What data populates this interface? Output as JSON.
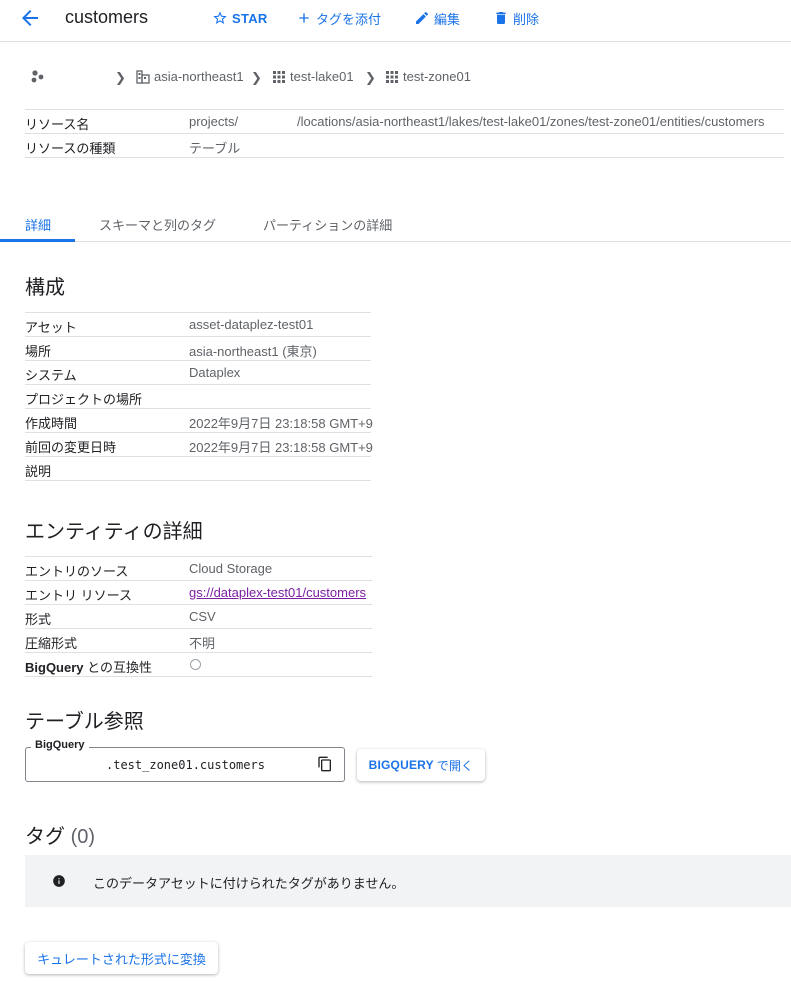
{
  "header": {
    "title": "customers",
    "star_label": "STAR",
    "add_tag_label": "タグを添付",
    "edit_label": "編集",
    "delete_label": "削除"
  },
  "breadcrumb": {
    "items": [
      "asia-northeast1",
      "test-lake01",
      "test-zone01"
    ]
  },
  "resource": {
    "name_label": "リソース名",
    "name_value_1": "projects/",
    "name_value_2": "/locations/asia-northeast1/lakes/test-lake01/zones/test-zone01/entities/customers",
    "type_label": "リソースの種類",
    "type_value": "テーブル"
  },
  "tabs": [
    "詳細",
    "スキーマと列のタグ",
    "パーティションの詳細"
  ],
  "config": {
    "heading": "構成",
    "rows": [
      {
        "k": "アセット",
        "v": "asset-dataplez-test01"
      },
      {
        "k": "場所",
        "v": "asia-northeast1 (東京)"
      },
      {
        "k": "システム",
        "v": "Dataplex"
      },
      {
        "k": "プロジェクトの場所",
        "v": ""
      },
      {
        "k": "作成時間",
        "v": "2022年9月7日 23:18:58 GMT+9"
      },
      {
        "k": "前回の変更日時",
        "v": "2022年9月7日 23:18:58 GMT+9"
      },
      {
        "k": "説明",
        "v": ""
      }
    ]
  },
  "entity": {
    "heading": "エンティティの詳細",
    "source_label": "エントリのソース",
    "source_value": "Cloud Storage",
    "resource_label": "エントリ リソース",
    "resource_value": "gs://dataplex-test01/customers",
    "format_label": "形式",
    "format_value": "CSV",
    "compression_label": "圧縮形式",
    "compression_value": "不明",
    "bq_compat_bold": "BigQuery",
    "bq_compat_rest": " との互換性"
  },
  "table_ref": {
    "heading": "テーブル参照",
    "field_label": "BigQuery",
    "field_value": ".test_zone01.customers",
    "open_btn_caps": "BIGQUERY",
    "open_btn_rest": "で開く"
  },
  "tags": {
    "heading": "タグ",
    "count": "(0)",
    "empty_message": "このデータアセットに付けられたタグがありません。"
  },
  "curate_button": "キュレートされた形式に変換"
}
